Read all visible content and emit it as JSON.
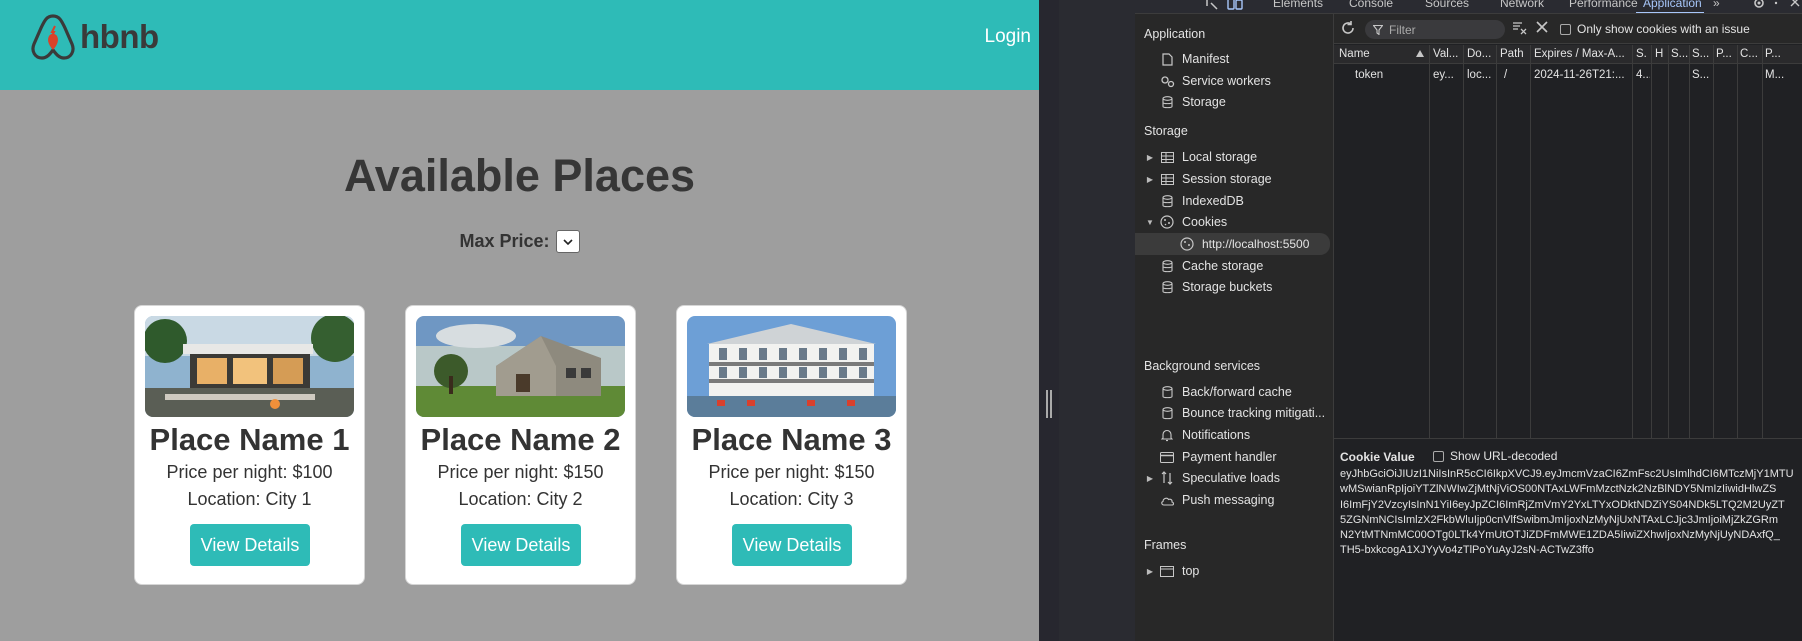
{
  "site": {
    "logo_text": "hbnb",
    "login": "Login",
    "title": "Available Places",
    "filter_label": "Max Price:",
    "places": [
      {
        "name": "Place Name 1",
        "price": "Price per night: $100",
        "location": "Location: City 1",
        "button": "View Details"
      },
      {
        "name": "Place Name 2",
        "price": "Price per night: $150",
        "location": "Location: City 2",
        "button": "View Details"
      },
      {
        "name": "Place Name 3",
        "price": "Price per night: $150",
        "location": "Location: City 3",
        "button": "View Details"
      }
    ]
  },
  "devtools": {
    "tabs": [
      "Elements",
      "Console",
      "Sources",
      "Network",
      "Performance",
      "Application",
      "»"
    ],
    "sidebar": {
      "application_header": "Application",
      "application_items": [
        "Manifest",
        "Service workers",
        "Storage"
      ],
      "storage_header": "Storage",
      "storage_items": [
        "Local storage",
        "Session storage",
        "IndexedDB",
        "Cookies",
        "http://localhost:5500",
        "Cache storage",
        "Storage buckets"
      ],
      "background_header": "Background services",
      "background_items": [
        "Back/forward cache",
        "Bounce tracking mitigati...",
        "Notifications",
        "Payment handler",
        "Speculative loads",
        "Push messaging"
      ],
      "frames_header": "Frames",
      "frames_items": [
        "top"
      ]
    },
    "toolbar": {
      "filter_placeholder": "Filter",
      "issue_checkbox": "Only show cookies with an issue"
    },
    "table": {
      "headers": [
        "Name",
        "Val...",
        "Do...",
        "Path",
        "Expires / Max-A...",
        "S.",
        "H",
        "S...",
        "S...",
        "P...",
        "C...",
        "P..."
      ],
      "rows": [
        [
          "token",
          "ey...",
          "loc...",
          "/",
          "2024-11-26T21:...",
          "4...",
          "",
          "",
          "S...",
          "",
          "",
          "M..."
        ]
      ]
    },
    "cookie_value": {
      "header": "Cookie Value",
      "decode_label": "Show URL-decoded",
      "lines": [
        "eyJhbGciOiJIUzI1NiIsInR5cCI6IkpXVCJ9.eyJmcmVzaCI6ZmFsc2UsImlhdCI6MTczMjY1MTU",
        "wMSwianRpIjoiYTZlNWIwZjMtNjViOS00NTAxLWFmMzctNzk2NzBlNDY5NmIzIiwidHlwZS",
        "I6ImFjY2VzcyIsInN1YiI6eyJpZCI6ImRjZmVmY2YxLTYxODktNDZiYS04NDk5LTQ2M2UyZT",
        "5ZGNmNCIsImlzX2FkbWluIjp0cnVlfSwibmJmIjoxNzMyNjUxNTAxLCJjc3JmIjoiMjZkZGRm",
        "N2YtMTNmMC00OTg0LTk4YmUtOTJiZDFmMWE1ZDA5IiwiZXhwIjoxNzMyNjUyNDAxfQ_",
        "TH5-bxkcogA1XJYyVo4zTlPoYuAyJ2sN-ACTwZ3ffo"
      ]
    }
  }
}
